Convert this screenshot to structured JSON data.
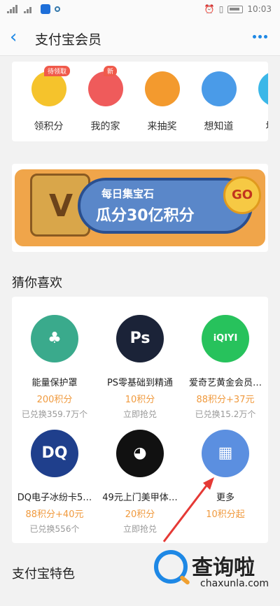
{
  "status_bar": {
    "time": "10:03"
  },
  "nav": {
    "title": "支付宝会员"
  },
  "quick_actions": [
    {
      "label": "领积分",
      "badge": "待领取",
      "icon": "calendar-coin-icon",
      "color": "#f5c32c"
    },
    {
      "label": "我的家",
      "badge": "新",
      "icon": "house-heart-icon",
      "color": "#ef5b5b"
    },
    {
      "label": "来抽奖",
      "badge": "",
      "icon": "lottery-icon",
      "color": "#f39a2e"
    },
    {
      "label": "想知道",
      "badge": "",
      "icon": "question-tag-icon",
      "color": "#4a9be8"
    },
    {
      "label": "堆堆",
      "badge": "",
      "icon": "game-icon",
      "color": "#3bb7e8"
    }
  ],
  "banner": {
    "line1": "每日集宝石",
    "line2": "瓜分30亿积分",
    "go": "GO"
  },
  "guess": {
    "title": "猜你喜欢",
    "items": [
      {
        "name": "能量保护罩",
        "price": "200积分",
        "sub": "已兑换359.7万个",
        "icon": "tree-icon",
        "bg": "#3aaa8c"
      },
      {
        "name": "PS零基础到精通",
        "price": "10积分",
        "sub": "立即抢兑",
        "icon": "ps-icon",
        "bg": "#1b2338"
      },
      {
        "name": "爱奇艺黄金会员…",
        "price": "88积分+37元",
        "sub": "已兑换15.2万个",
        "icon": "iqiyi-icon",
        "bg": "#27c25c"
      },
      {
        "name": "DQ电子冰纷卡5…",
        "price": "88积分+40元",
        "sub": "已兑换556个",
        "icon": "dq-icon",
        "bg": "#1f3f8c"
      },
      {
        "name": "49元上门美甲体…",
        "price": "20积分",
        "sub": "立即抢兑",
        "icon": "bear-icon",
        "bg": "#111111"
      },
      {
        "name": "更多",
        "price": "10积分起",
        "sub": "",
        "icon": "grid-icon",
        "bg": "#5b8fe0"
      }
    ]
  },
  "features": {
    "title": "支付宝特色"
  },
  "watermark": {
    "text": "查询啦",
    "sub": "chaxunla.com"
  }
}
